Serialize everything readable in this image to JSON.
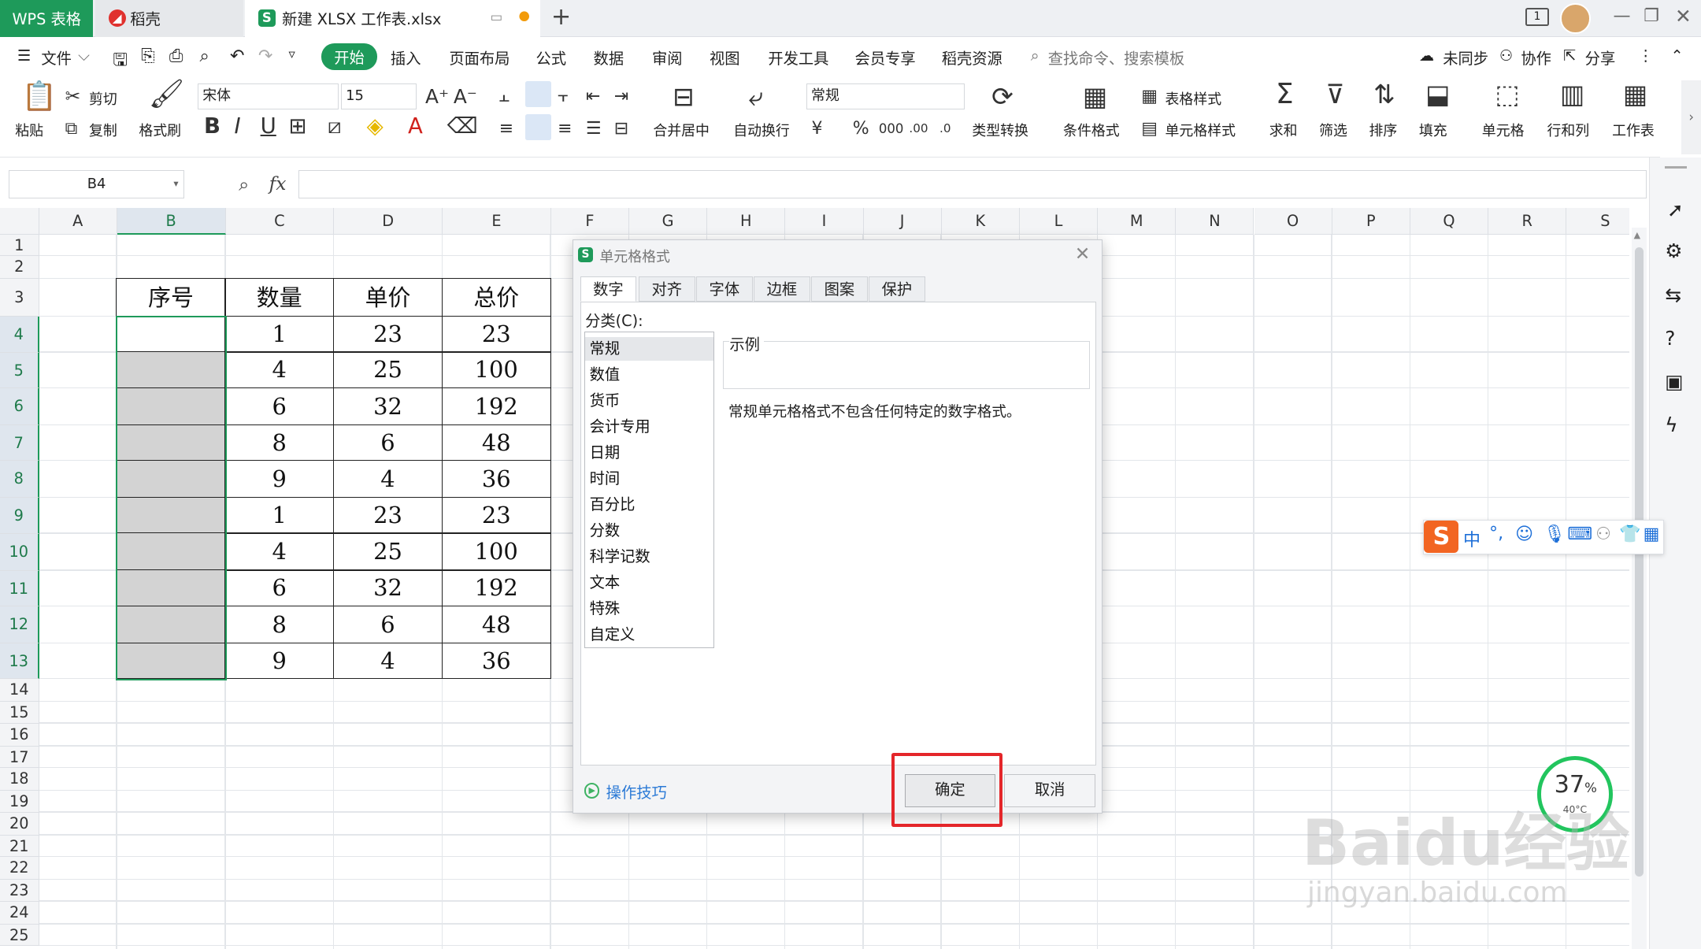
{
  "tabs": {
    "wps": "WPS 表格",
    "daoke": "稻壳",
    "file": "新建 XLSX 工作表.xlsx",
    "add": "+"
  },
  "menu": {
    "file": "文件",
    "items": [
      "开始",
      "插入",
      "页面布局",
      "公式",
      "数据",
      "审阅",
      "视图",
      "开发工具",
      "会员专享",
      "稻壳资源"
    ],
    "search": "查找命令、搜索模板",
    "sync": "未同步",
    "collab": "协作",
    "share": "分享"
  },
  "ribbon": {
    "paste": "粘贴",
    "cut": "剪切",
    "copy": "复制",
    "format_painter": "格式刷",
    "font_name": "宋体",
    "font_size": "15",
    "merge_center": "合并居中",
    "auto_wrap": "自动换行",
    "number_format": "常规",
    "type_convert": "类型转换",
    "cond_format": "条件格式",
    "table_style": "表格样式",
    "cell_style": "单元格样式",
    "sum": "求和",
    "filter": "筛选",
    "sort": "排序",
    "fill": "填充",
    "cell": "单元格",
    "row_col": "行和列",
    "worksheet": "工作表"
  },
  "formula_bar": {
    "name_box": "B4",
    "fx": "fx",
    "value": ""
  },
  "columns": [
    "A",
    "B",
    "C",
    "D",
    "E",
    "F",
    "G",
    "H",
    "I",
    "J",
    "K",
    "L",
    "M",
    "N",
    "O",
    "P",
    "Q",
    "R",
    "S"
  ],
  "rows": [
    "1",
    "2",
    "3",
    "4",
    "5",
    "6",
    "7",
    "8",
    "9",
    "10",
    "11",
    "12",
    "13",
    "14",
    "15",
    "16",
    "17",
    "18",
    "19",
    "20",
    "21",
    "22",
    "23",
    "24",
    "25"
  ],
  "table": {
    "headers": [
      "序号",
      "数量",
      "单价",
      "总价"
    ],
    "rows": [
      [
        "",
        "1",
        "23",
        "23"
      ],
      [
        "",
        "4",
        "25",
        "100"
      ],
      [
        "",
        "6",
        "32",
        "192"
      ],
      [
        "",
        "8",
        "6",
        "48"
      ],
      [
        "",
        "9",
        "4",
        "36"
      ],
      [
        "",
        "1",
        "23",
        "23"
      ],
      [
        "",
        "4",
        "25",
        "100"
      ],
      [
        "",
        "6",
        "32",
        "192"
      ],
      [
        "",
        "8",
        "6",
        "48"
      ],
      [
        "",
        "9",
        "4",
        "36"
      ]
    ]
  },
  "dialog": {
    "title": "单元格格式",
    "tabs": [
      "数字",
      "对齐",
      "字体",
      "边框",
      "图案",
      "保护"
    ],
    "category_label": "分类(C):",
    "categories": [
      "常规",
      "数值",
      "货币",
      "会计专用",
      "日期",
      "时间",
      "百分比",
      "分数",
      "科学记数",
      "文本",
      "特殊",
      "自定义"
    ],
    "sample_label": "示例",
    "description": "常规单元格格式不包含任何特定的数字格式。",
    "tips": "操作技巧",
    "ok": "确定",
    "cancel": "取消"
  },
  "ime": {
    "label": "中"
  },
  "perf": {
    "percent": "37",
    "unit": "%",
    "temp": "40°C"
  },
  "watermark": {
    "brand": "Baidu经验",
    "url": "jingyan.baidu.com"
  }
}
